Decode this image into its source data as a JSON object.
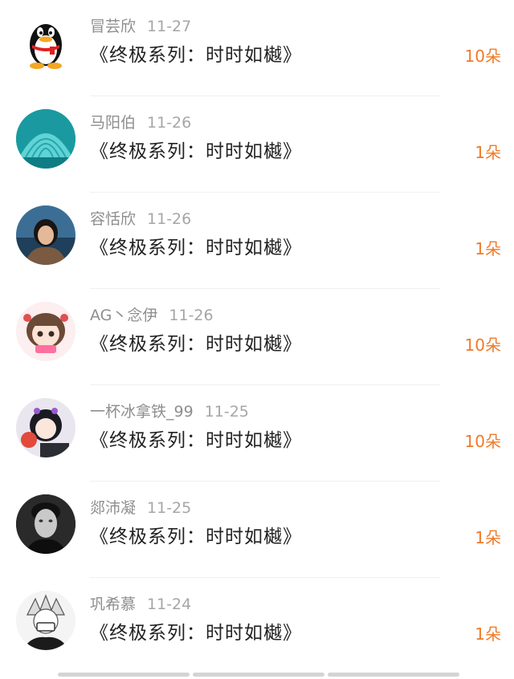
{
  "records": [
    {
      "name": "冒芸欣",
      "date": "11-27",
      "title": "《终极系列：时时如樾》",
      "amount": "10朵",
      "avatar": "qq-penguin-icon"
    },
    {
      "name": "马阳伯",
      "date": "11-26",
      "title": "《终极系列：时时如樾》",
      "amount": "1朵",
      "avatar": "seashell-avatar"
    },
    {
      "name": "容恬欣",
      "date": "11-26",
      "title": "《终极系列：时时如樾》",
      "amount": "1朵",
      "avatar": "girl-seaside-avatar"
    },
    {
      "name": "AG丶念伊",
      "date": "11-26",
      "title": "《终极系列：时时如樾》",
      "amount": "10朵",
      "avatar": "anime-girl-pink-avatar"
    },
    {
      "name": "一杯冰拿铁_99",
      "date": "11-25",
      "title": "《终极系列：时时如樾》",
      "amount": "10朵",
      "avatar": "anime-girl-pingpong-avatar"
    },
    {
      "name": "郯沛凝",
      "date": "11-25",
      "title": "《终极系列：时时如樾》",
      "amount": "1朵",
      "avatar": "man-bw-portrait-avatar"
    },
    {
      "name": "巩希慕",
      "date": "11-24",
      "title": "《终极系列：时时如樾》",
      "amount": "1朵",
      "avatar": "anime-boy-mask-avatar"
    }
  ],
  "colors": {
    "amount": "#f07a28",
    "name": "#8e8e8e",
    "title": "#222222"
  }
}
